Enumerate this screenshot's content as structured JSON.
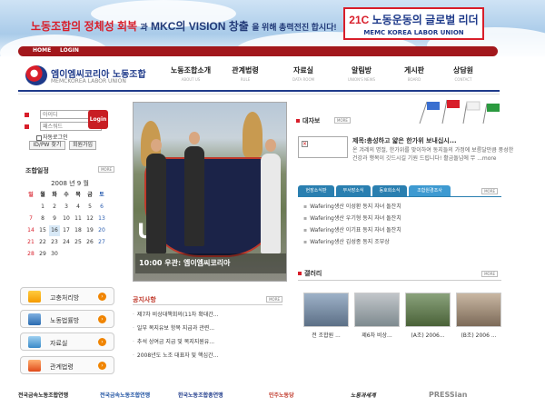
{
  "header": {
    "slogan_part1": "노동조합의 정체성 회복",
    "slogan_mid": "과",
    "slogan_part2": "MKC의 VISION 창출",
    "slogan_end": "을 위해 총력전진 합시다!",
    "leader_title_prefix": "21C",
    "leader_title": "노동운동의 글로벌 리더",
    "leader_sub": "MEMC KOREA LABOR UNION",
    "top_links": [
      "HOME",
      "LOGIN"
    ]
  },
  "logo": {
    "name": "엠이엠씨코리아 노동조합",
    "sub": "MEMCKOREA LABOR UNION"
  },
  "nav": [
    {
      "label": "노동조합소개",
      "sub": "ABOUT US"
    },
    {
      "label": "관계법령",
      "sub": "RULE"
    },
    {
      "label": "자료실",
      "sub": "DATA ROOM"
    },
    {
      "label": "알림방",
      "sub": "UNION'S NEWS"
    },
    {
      "label": "게시판",
      "sub": "BOARD"
    },
    {
      "label": "상담원",
      "sub": "CONTACT"
    }
  ],
  "login": {
    "id_placeholder": "아이디",
    "pw_placeholder": "패스워드",
    "button": "Login",
    "auto_login": "자동로그인",
    "find_id": "ID/PW 찾기",
    "join": "회원가입"
  },
  "calendar": {
    "title": "조합일정",
    "more": "MORE",
    "year_month": "2008 년 9 월",
    "weekdays": [
      "일",
      "월",
      "화",
      "수",
      "목",
      "금",
      "토"
    ],
    "days": [
      "",
      "1",
      "2",
      "3",
      "4",
      "5",
      "6",
      "7",
      "8",
      "9",
      "10",
      "11",
      "12",
      "13",
      "14",
      "15",
      "16",
      "17",
      "18",
      "19",
      "20",
      "21",
      "22",
      "23",
      "24",
      "25",
      "26",
      "27",
      "28",
      "29",
      "30",
      "",
      "",
      "",
      ""
    ]
  },
  "left_buttons": [
    "고충처리방",
    "노동법률방",
    "자료실",
    "관계법령"
  ],
  "photo": {
    "caption": "10:00   우관: 엠이엠씨코리아"
  },
  "notice": {
    "title": "공지사항",
    "more": "MORE",
    "items": [
      "제7차 비상대책회의(11차 확대간...",
      "일부 복지유보 항목 지급과 관련...",
      "추석 상여금 지급 및 복지지원유...",
      "2008년도 노조 대표자 및 핵심간..."
    ]
  },
  "daebo": {
    "title": "대자보",
    "more": "MORE",
    "headline": "제목:총성하고 얇은 한가위 보내십시...",
    "body": "온 겨레의 명절, 한가위를 맞이하여 동지들의 가정에 보름달만큼 풍성한 건강과 행복이 깃드시길 기원 드립니다! 활금돌넘에 무 ...more"
  },
  "tabs": {
    "labels": [
      "현장소식판",
      "부서장소식",
      "동호회소식",
      "조합원경조사"
    ],
    "more": "MORE"
  },
  "news": [
    "Wafering생산 이성환 동지 자녀 돌잔치",
    "Wafering생산 우기형 동지 자녀 돌잔치",
    "Wafering생산 이기표 동지 자녀 돌잔치",
    "Wafering생산 김성종 동지 조부상"
  ],
  "gallery": {
    "title": "갤러리",
    "more": "MORE",
    "captions": [
      "전 조합원 ...",
      "제6차 비상...",
      "(A조) 2006...",
      "(B조) 2006 ..."
    ]
  },
  "footer": [
    "전국금속노동조합연맹",
    "전국금속노동조합연맹",
    "한국노동조합총연맹",
    "민주노동당",
    "노동과세계",
    "PRESSian"
  ]
}
